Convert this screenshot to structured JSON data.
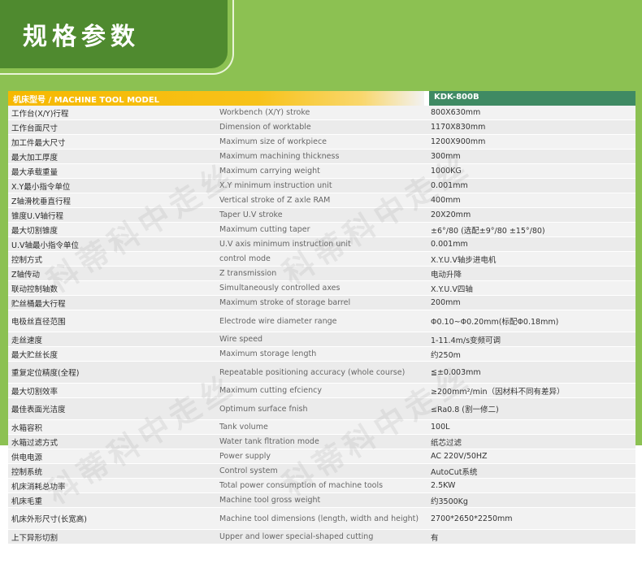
{
  "banner": {
    "title": "规格参数"
  },
  "table": {
    "header_model_label": "机床型号 / MACHINE TOOL MODEL",
    "header_model_value": "KDK-800B",
    "rows": [
      {
        "cn": "工作台(X/Y)行程",
        "en": "Workbench (X/Y) stroke",
        "val": "800X630mm"
      },
      {
        "cn": "工作台面尺寸",
        "en": "Dimension of worktable",
        "val": "1170X830mm"
      },
      {
        "cn": "加工件最大尺寸",
        "en": "Maximum size of workpiece",
        "val": "1200X900mm"
      },
      {
        "cn": "最大加工厚度",
        "en": "Maximum machining thickness",
        "val": "300mm"
      },
      {
        "cn": "最大承载重量",
        "en": "Maximum carrying weight",
        "val": "1000KG"
      },
      {
        "cn": "X.Y最小指令单位",
        "en": "X.Y minimum instruction unit",
        "val": "0.001mm"
      },
      {
        "cn": "Z轴滑枕垂直行程",
        "en": "Vertical stroke of Z axle RAM",
        "val": "400mm"
      },
      {
        "cn": "锥度U.V轴行程",
        "en": "Taper U.V stroke",
        "val": "20X20mm"
      },
      {
        "cn": "最大切割锥度",
        "en": "Maximum cutting taper",
        "val": "±6°/80 (选配±9°/80  ±15°/80)"
      },
      {
        "cn": "U.V轴最小指令单位",
        "en": "U.V axis minimum instruction unit",
        "val": "0.001mm"
      },
      {
        "cn": "控制方式",
        "en": "control mode",
        "val": "X.Y.U.V轴步进电机"
      },
      {
        "cn": "Z轴传动",
        "en": "Z transmission",
        "val": "电动升降"
      },
      {
        "cn": "联动控制轴数",
        "en": "Simultaneously controlled axes",
        "val": "X.Y.U.V四轴"
      },
      {
        "cn": "贮丝桶最大行程",
        "en": "Maximum stroke of storage barrel",
        "val": "200mm"
      },
      {
        "cn": "电极丝直径范围",
        "en": "Electrode wire diameter range",
        "val": "Φ0.10~Φ0.20mm(标配Φ0.18mm)"
      },
      {
        "cn": "走丝速度",
        "en": "Wire speed",
        "val": "1-11.4m/s变频可调"
      },
      {
        "cn": "最大贮丝长度",
        "en": "Maximum storage length",
        "val": "约250m"
      },
      {
        "cn": "重复定位精度(全程)",
        "en": "Repeatable positioning accuracy (whole course)",
        "val": "≦±0.003mm"
      },
      {
        "cn": "最大切割效率",
        "en": "Maximum cutting efciency",
        "val": "≥200mm²/min（因材料不同有差异）"
      },
      {
        "cn": "最佳表面光洁度",
        "en": "Optimum surface fnish",
        "val": "≤Ra0.8 (割一修二)"
      },
      {
        "cn": "水箱容积",
        "en": "Tank volume",
        "val": "100L"
      },
      {
        "cn": "水箱过滤方式",
        "en": "Water tank fltration mode",
        "val": "纸芯过滤"
      },
      {
        "cn": "供电电源",
        "en": "Power supply",
        "val": "AC 220V/50HZ"
      },
      {
        "cn": "控制系统",
        "en": "Control system",
        "val": "AutoCut系统"
      },
      {
        "cn": "机床消耗总功率",
        "en": "Total power consumption of machine tools",
        "val": "2.5KW"
      },
      {
        "cn": "机床毛重",
        "en": "Machine tool gross weight",
        "val": "约3500Kg"
      },
      {
        "cn": "机床外形尺寸(长宽高)",
        "en": "Machine tool dimensions (length, width and height)",
        "val": "2700*2650*2250mm"
      },
      {
        "cn": "上下异形切割",
        "en": "Upper and lower special-shaped cutting",
        "val": "有"
      }
    ]
  },
  "watermark": {
    "text": "科蒂科中走丝"
  }
}
